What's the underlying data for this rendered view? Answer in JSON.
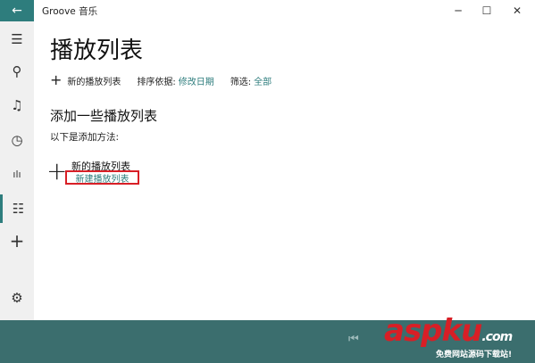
{
  "window": {
    "title": "Groove 音乐",
    "back_icon": "←",
    "min_icon": "─",
    "max_icon": "☐",
    "close_icon": "✕"
  },
  "rail": {
    "items": [
      {
        "name": "menu",
        "icon": "☰"
      },
      {
        "name": "search",
        "icon": "⚲"
      },
      {
        "name": "music",
        "icon": "♫"
      },
      {
        "name": "recent",
        "icon": "◷"
      },
      {
        "name": "now-playing",
        "icon": "ılı"
      },
      {
        "name": "playlists",
        "icon": "☷"
      },
      {
        "name": "add",
        "icon": "+"
      },
      {
        "name": "settings",
        "icon": "⚙"
      }
    ]
  },
  "page": {
    "title": "播放列表",
    "toolbar": {
      "new_playlist": "新的播放列表",
      "sort_label": "排序依据:",
      "sort_value": "修改日期",
      "filter_label": "筛选:",
      "filter_value": "全部"
    },
    "section_title": "添加一些播放列表",
    "section_sub": "以下是添加方法:",
    "add": {
      "title": "新的播放列表",
      "link": "新建播放列表"
    }
  },
  "player": {
    "prev_icon": "⏮"
  },
  "watermark": {
    "brand": "aspku",
    "suffix": ".com",
    "sub": "免费网站源码下载站!"
  },
  "colors": {
    "accent": "#2e7d7d",
    "highlight": "#d81f26",
    "player": "#3b6e6e"
  }
}
